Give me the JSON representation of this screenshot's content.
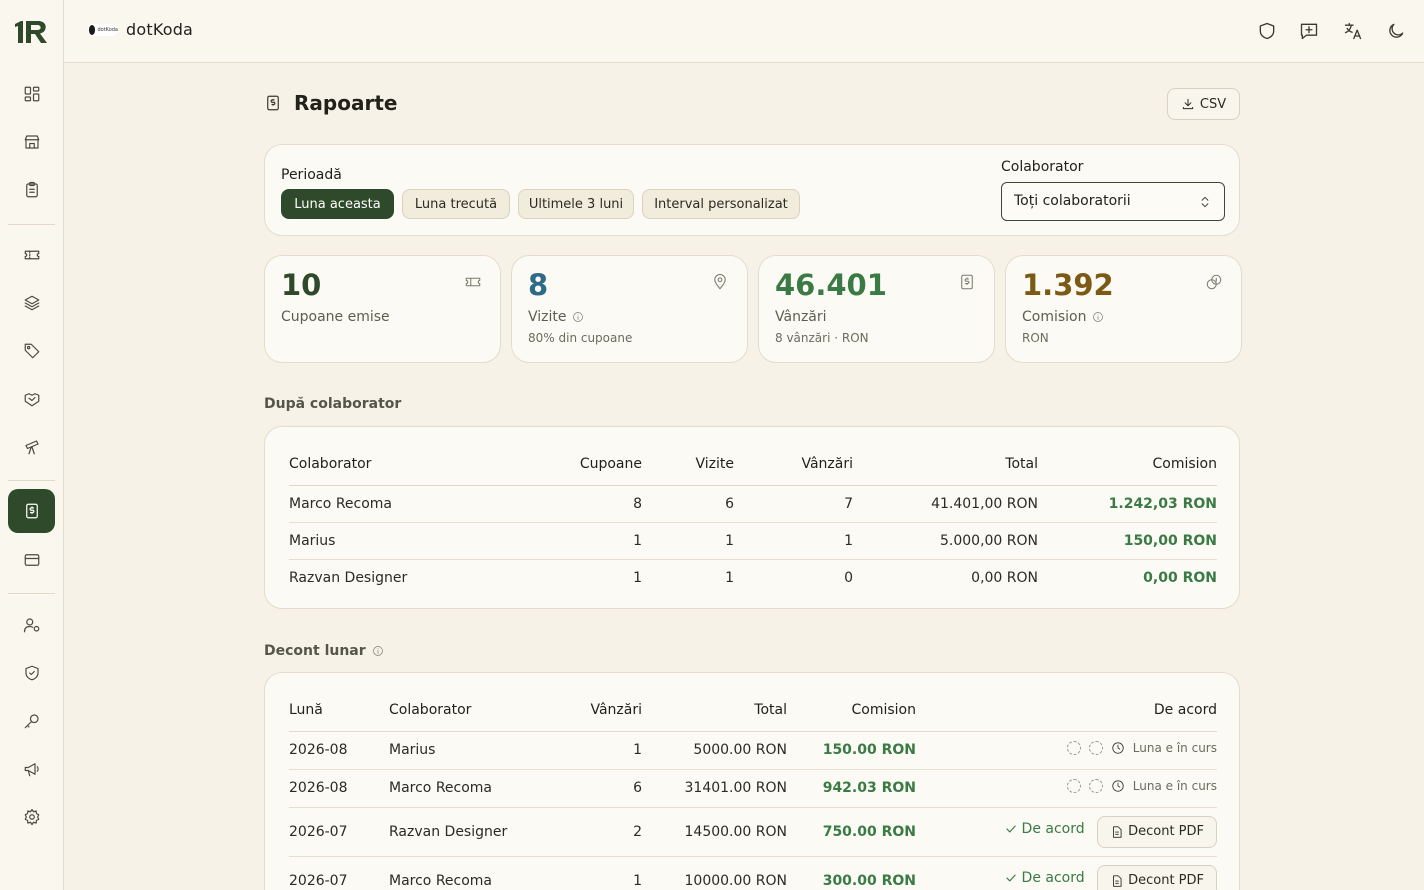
{
  "topbar": {
    "brand_name": "dotKoda",
    "brand_mini": "dotKoda",
    "icons": [
      "shield-icon",
      "feedback-icon",
      "translate-icon",
      "moon-icon"
    ]
  },
  "sidebar": {
    "logo": "1R",
    "items": [
      "dashboard",
      "store",
      "clipboard",
      "ticket",
      "layers",
      "tag",
      "handshake",
      "telescope",
      "reports",
      "card",
      "user-settings",
      "shield-check",
      "key",
      "megaphone",
      "settings"
    ],
    "active": "reports"
  },
  "page": {
    "title": "Rapoarte",
    "csv_label": "CSV"
  },
  "filters": {
    "period_label": "Perioadă",
    "periods": [
      "Luna aceasta",
      "Luna trecută",
      "Ultimele 3 luni",
      "Interval personalizat"
    ],
    "active_period": "Luna aceasta",
    "collaborator_label": "Colaborator",
    "collaborator_value": "Toți colaboratorii"
  },
  "stats": [
    {
      "value": "10",
      "label": "Cupoane emise",
      "sub": "",
      "color": "#2f4a2a",
      "icon": "ticket-icon"
    },
    {
      "value": "8",
      "label": "Vizite",
      "sub": "80% din cupoane",
      "color": "#2f6a86",
      "icon": "map-pin-icon"
    },
    {
      "value": "46.401",
      "label": "Vânzări",
      "sub": "8 vânzări · RON",
      "color": "#3a7a45",
      "icon": "receipt-icon"
    },
    {
      "value": "1.392",
      "label": "Comision",
      "sub": "RON",
      "color": "#7a5a14",
      "icon": "coins-icon"
    }
  ],
  "by_collaborator": {
    "title": "După colaborator",
    "headers": [
      "Colaborator",
      "Cupoane",
      "Vizite",
      "Vânzări",
      "Total",
      "Comision"
    ],
    "rows": [
      [
        "Marco Recoma",
        "8",
        "6",
        "7",
        "41.401,00 RON",
        "1.242,03 RON"
      ],
      [
        "Marius",
        "1",
        "1",
        "1",
        "5.000,00 RON",
        "150,00 RON"
      ],
      [
        "Razvan Designer",
        "1",
        "1",
        "0",
        "0,00 RON",
        "0,00 RON"
      ]
    ]
  },
  "monthly": {
    "title": "Decont lunar",
    "headers": [
      "Lună",
      "Colaborator",
      "Vânzări",
      "Total",
      "Comision",
      "De acord"
    ],
    "pending_label": "Luna e în curs",
    "agree_label": "De acord",
    "pdf_label": "Decont PDF",
    "rows": [
      {
        "month": "2026-08",
        "collaborator": "Marius",
        "sales": "1",
        "total": "5000.00 RON",
        "commission": "150.00 RON"
      },
      {
        "month": "2026-08",
        "collaborator": "Marco Recoma",
        "sales": "6",
        "total": "31401.00 RON",
        "commission": "942.03 RON"
      },
      {
        "month": "2026-07",
        "collaborator": "Razvan Designer",
        "sales": "2",
        "total": "14500.00 RON",
        "commission": "750.00 RON"
      },
      {
        "month": "2026-07",
        "collaborator": "Marco Recoma",
        "sales": "1",
        "total": "10000.00 RON",
        "commission": "300.00 RON"
      }
    ]
  }
}
